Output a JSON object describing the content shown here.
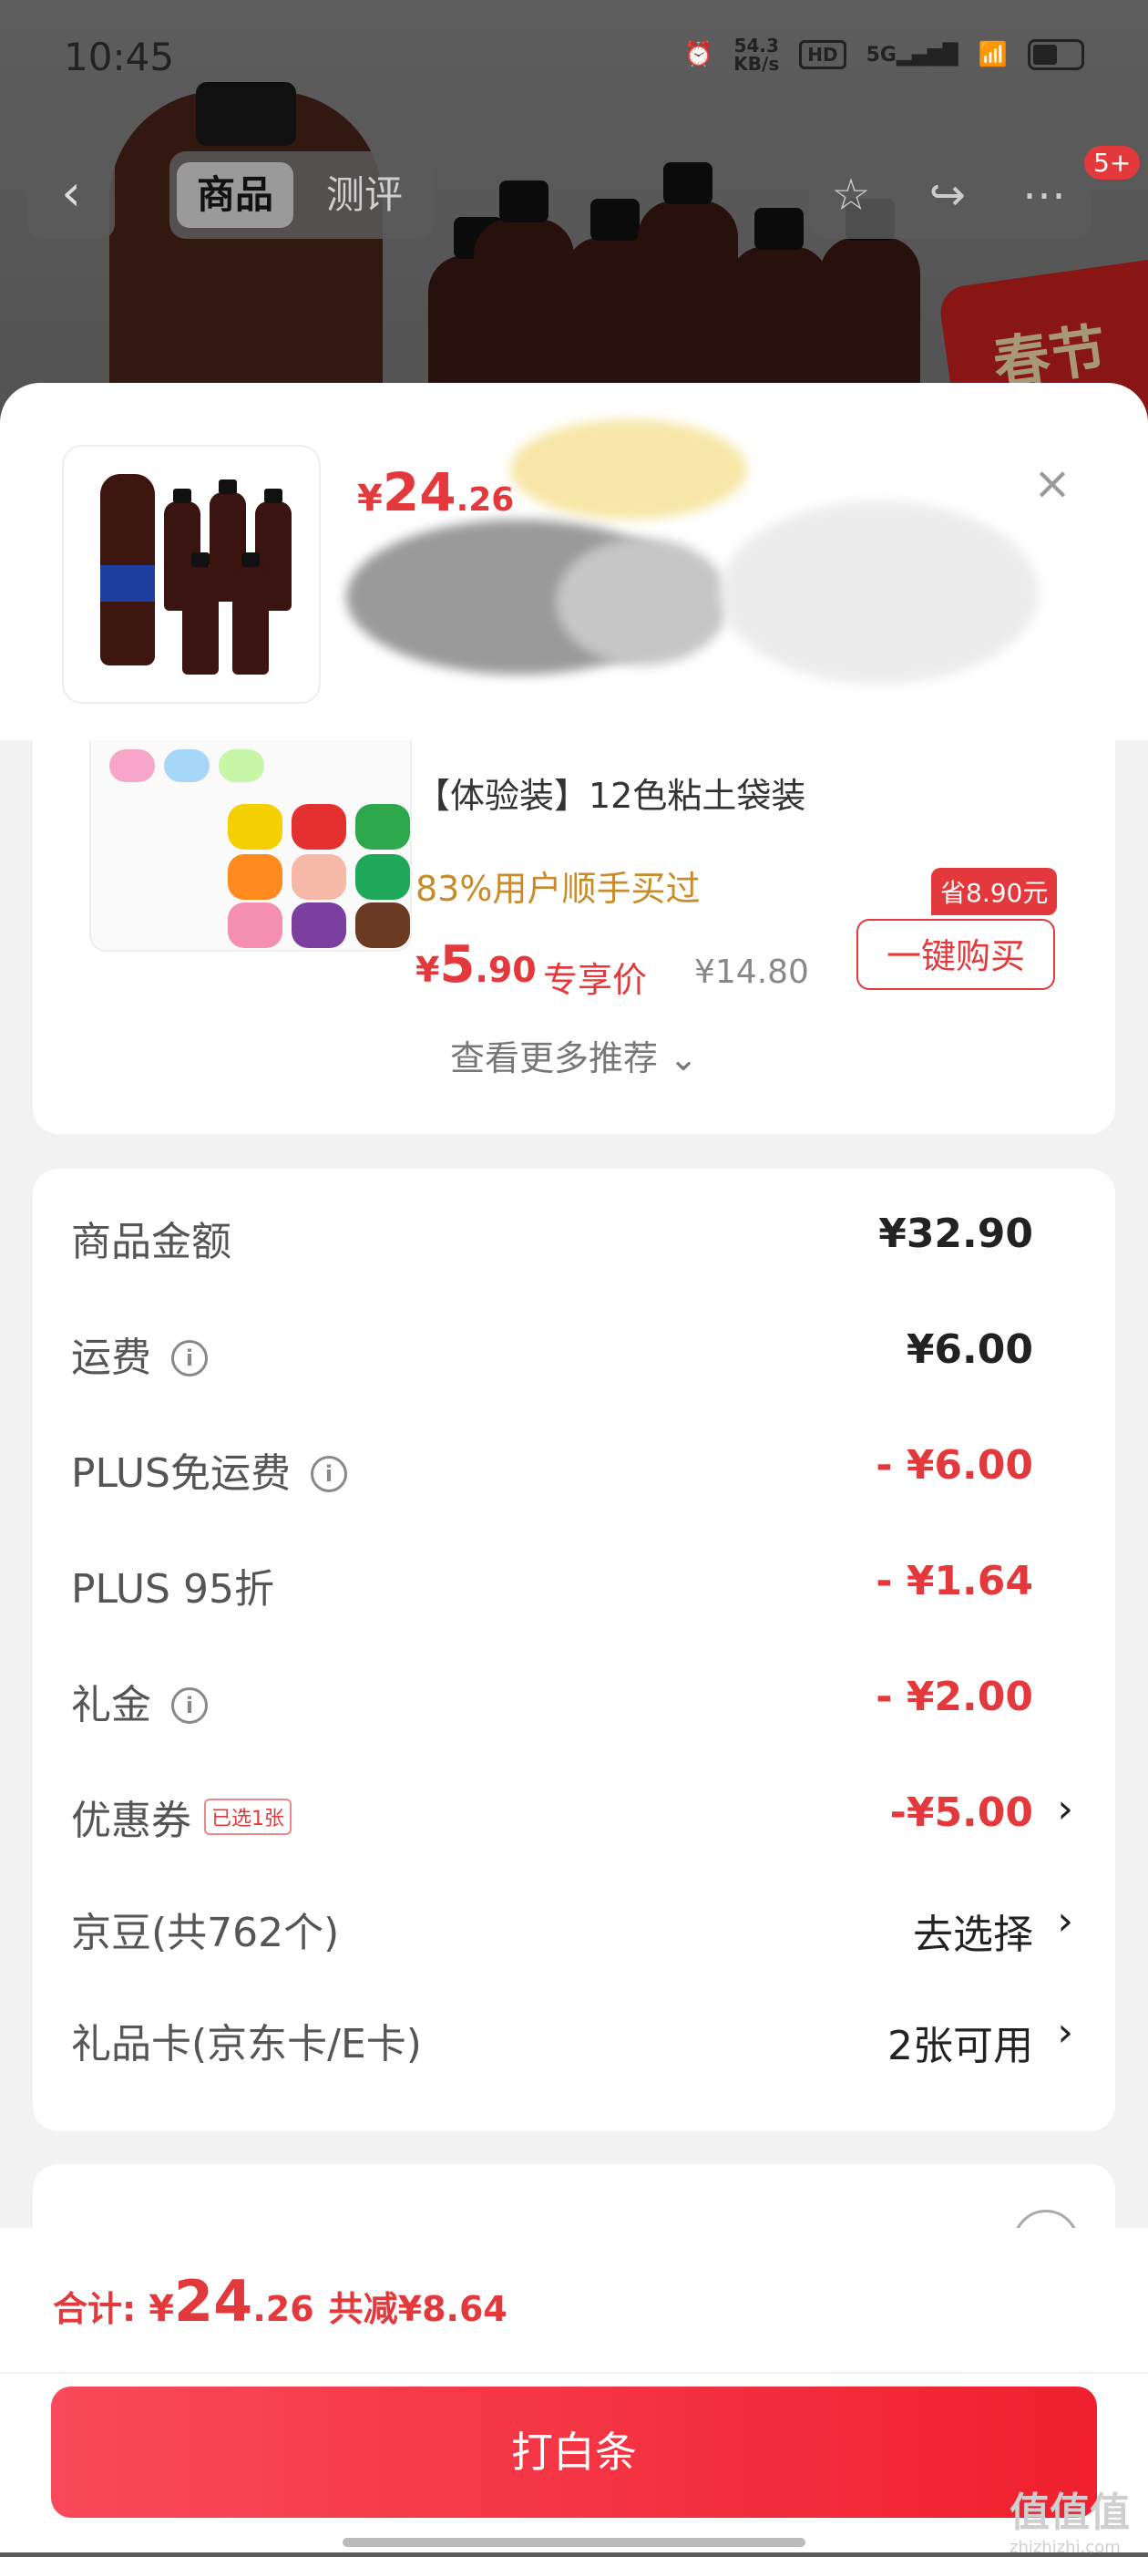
{
  "status_bar": {
    "time": "10:45",
    "net_speed_value": "54.3",
    "net_speed_unit": "KB/s",
    "hd": "HD",
    "network": "5G"
  },
  "nav": {
    "tabs": [
      {
        "label": "商品",
        "active": true
      },
      {
        "label": "测评",
        "active": false
      }
    ],
    "badge": "5+"
  },
  "banner": {
    "promo_text": "春节"
  },
  "sheet": {
    "price": {
      "currency": "¥",
      "integer": "24",
      "decimal": ".26"
    },
    "close_symbol": "×"
  },
  "recommendation": {
    "title": "【体验装】12色粘土袋装",
    "social_proof": "83%用户顺手买过",
    "price": {
      "currency": "¥",
      "integer": "5",
      "decimal": ".90"
    },
    "price_label": "专享价",
    "original_price": "¥14.80",
    "buy_button": "一键购买",
    "save_tag": "省8.90元",
    "see_more": "查看更多推荐"
  },
  "breakdown": [
    {
      "label": "商品金额",
      "value": "¥32.90",
      "info": false,
      "chip": "",
      "red": false,
      "chevron": false
    },
    {
      "label": "运费",
      "value": "¥6.00",
      "info": true,
      "chip": "",
      "red": false,
      "chevron": false
    },
    {
      "label": "PLUS免运费",
      "value": "- ¥6.00",
      "info": true,
      "chip": "",
      "red": true,
      "chevron": false
    },
    {
      "label": "PLUS 95折",
      "value": "- ¥1.64",
      "info": false,
      "chip": "",
      "red": true,
      "chevron": false
    },
    {
      "label": "礼金",
      "value": "- ¥2.00",
      "info": true,
      "chip": "",
      "red": true,
      "chevron": false
    },
    {
      "label": "优惠券",
      "value": "-¥5.00",
      "info": false,
      "chip": "已选1张",
      "red": true,
      "chevron": true
    },
    {
      "label": "京豆(共762个)",
      "value": "去选择",
      "info": false,
      "chip": "",
      "red": false,
      "chevron": true
    },
    {
      "label": "礼品卡(京东卡/E卡)",
      "value": "2张可用",
      "info": false,
      "chip": "",
      "red": false,
      "chevron": true
    }
  ],
  "footer": {
    "total_label": "合计:",
    "total": {
      "currency": "¥",
      "integer": "24",
      "decimal": ".26"
    },
    "saved": "共减¥8.64",
    "pay_button": "打白条"
  },
  "watermark": {
    "main": "值值值",
    "sub": "zhizhizhi.com"
  },
  "colors": {
    "accent": "#e4393c",
    "social_proof": "#c98a2a"
  }
}
